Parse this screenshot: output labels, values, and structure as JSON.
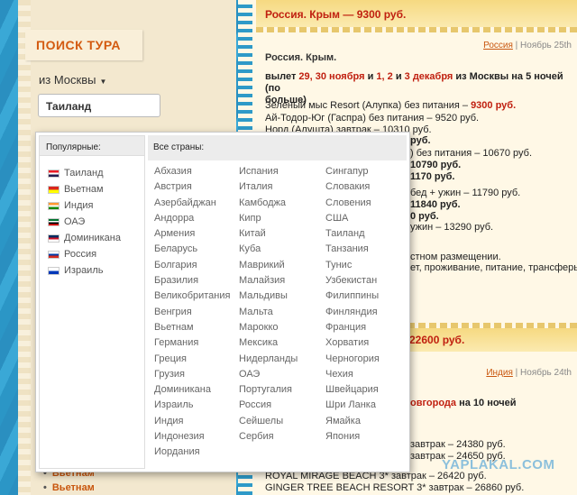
{
  "left": {
    "search_title": "ПОИСК ТУРА",
    "from_city": "из Москвы",
    "country_value": "Таиланд",
    "links": [
      "Вьетнам",
      "Вьетнам"
    ]
  },
  "header": {
    "title": "Россия. Крым — 9300 руб."
  },
  "post1": {
    "meta_country": "Россия",
    "meta_date": "Ноябрь 25th",
    "title": "Россия. Крым.",
    "dates_prefix": "вылет",
    "dates_red1": "29, 30 ноября",
    "dates_mid": "и",
    "dates_red2": "1, 2",
    "dates_mid2": "и",
    "dates_red3": "3 декабря",
    "dates_suffix": "из Москвы на 5 ночей (по",
    "dates_line2": "больше)",
    "line1_text": "Зеленый мыс Resort (Алупка) без питания –",
    "line1_price": "9300 руб.",
    "line2": "Ай-Тодор-Юг (Гаспра) без питания – 9520 руб.",
    "line3": "Норд (Алушта) завтрак – 10310 руб.",
    "line4": "руб.",
    "line5": ") без питания – 10670 руб.",
    "line6": "10790 руб.",
    "line7": "1170 руб.",
    "line8": "бед + ужин – 11790 руб.",
    "line9": "11840 руб.",
    "line10": "0 руб.",
    "line11": "ужин – 13290 руб.",
    "line12": "стном размещении.",
    "line13": "ет, проживание, питание, трансферы"
  },
  "band2": {
    "price": "22600 руб."
  },
  "post2": {
    "meta_country": "Индия",
    "meta_date": "Ноябрь 24th",
    "title_tail": "овгорода",
    "title_end": "на 10 ночей",
    "l1": "завтрак – 24380 руб.",
    "l2": "завтрак – 24650 руб.",
    "l3": "ROYAL MIRAGE BEACH 3* завтрак – 26420 руб.",
    "l4": "GINGER TREE BEACH RESORT 3* завтрак – 26860 руб."
  },
  "watermark": "YAPLAKAL.COM",
  "dropdown": {
    "popular_label": "Популярные:",
    "popular": [
      "Таиланд",
      "Вьетнам",
      "Индия",
      "ОАЭ",
      "Доминикана",
      "Россия",
      "Израиль"
    ],
    "all_label": "Все страны:",
    "col1": [
      "Абхазия",
      "Австрия",
      "Азербайджан",
      "Андорра",
      "Армения",
      "Беларусь",
      "Болгария",
      "Бразилия",
      "Великобритания",
      "Венгрия",
      "Вьетнам",
      "Германия",
      "Греция",
      "Грузия",
      "Доминикана",
      "Израиль",
      "Индия",
      "Индонезия",
      "Иордания"
    ],
    "col2": [
      "Испания",
      "Италия",
      "Камбоджа",
      "Кипр",
      "Китай",
      "Куба",
      "Маврикий",
      "Малайзия",
      "Мальдивы",
      "Мальта",
      "Марокко",
      "Мексика",
      "Нидерланды",
      "ОАЭ",
      "Португалия",
      "Россия",
      "Сейшелы",
      "Сербия"
    ],
    "col3": [
      "Сингапур",
      "Словакия",
      "Словения",
      "США",
      "Таиланд",
      "Танзания",
      "Тунис",
      "Узбекистан",
      "Филиппины",
      "Финляндия",
      "Франция",
      "Хорватия",
      "Черногория",
      "Чехия",
      "Швейцария",
      "Шри Ланка",
      "Ямайка",
      "Япония"
    ]
  },
  "flag_colors": {
    "Таиланд": [
      "#ed1c24",
      "#ffffff",
      "#241d4f"
    ],
    "Вьетнам": [
      "#da251d",
      "#ffff00"
    ],
    "Индия": [
      "#ff9933",
      "#ffffff",
      "#138808"
    ],
    "ОАЭ": [
      "#00732f",
      "#ffffff",
      "#000000",
      "#ff0000"
    ],
    "Доминикана": [
      "#002d62",
      "#ce1126",
      "#ffffff"
    ],
    "Россия": [
      "#ffffff",
      "#0039a6",
      "#d52b1e"
    ],
    "Израиль": [
      "#ffffff",
      "#0038b8"
    ]
  }
}
